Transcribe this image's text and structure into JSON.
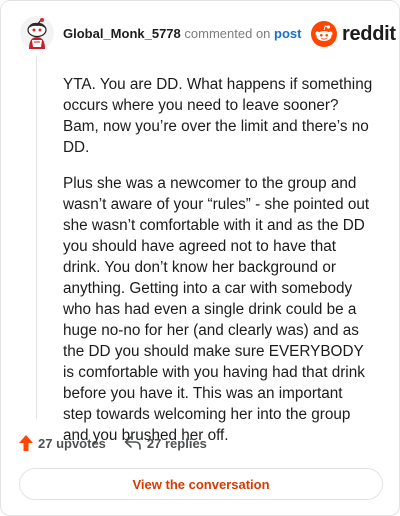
{
  "header": {
    "username": "Global_Monk_5778",
    "commented_text": "commented on",
    "post_link": "post",
    "logo_text": "reddit"
  },
  "comment": {
    "paragraphs": [
      "YTA. You are DD. What happens if something occurs where you need to leave sooner? Bam, now you’re over the limit and there’s no DD.",
      "Plus she was a newcomer to the group and wasn’t aware of your “rules” - she pointed out she wasn’t comfortable with it and as the DD you should have agreed not to have that drink. You don’t know her background or anything. Getting into a car with somebody who has had even a single drink could be a huge no-no for her (and clearly was) and as the DD you should make sure EVERYBODY is comfortable with you having had that drink before you have it. This was an important step towards welcoming her into the group and you brushed her off."
    ]
  },
  "actions": {
    "upvotes": "27 upvotes",
    "replies": "27 replies"
  },
  "view_button": "View the conversation",
  "colors": {
    "brand": "#ff4500",
    "link": "#1a6fc6",
    "button_text": "#d93a00"
  },
  "icons": {
    "avatar": "snoo-avatar",
    "logo": "reddit-snoo-icon",
    "upvote": "upvote-arrow-icon",
    "reply": "reply-arrow-icon"
  }
}
